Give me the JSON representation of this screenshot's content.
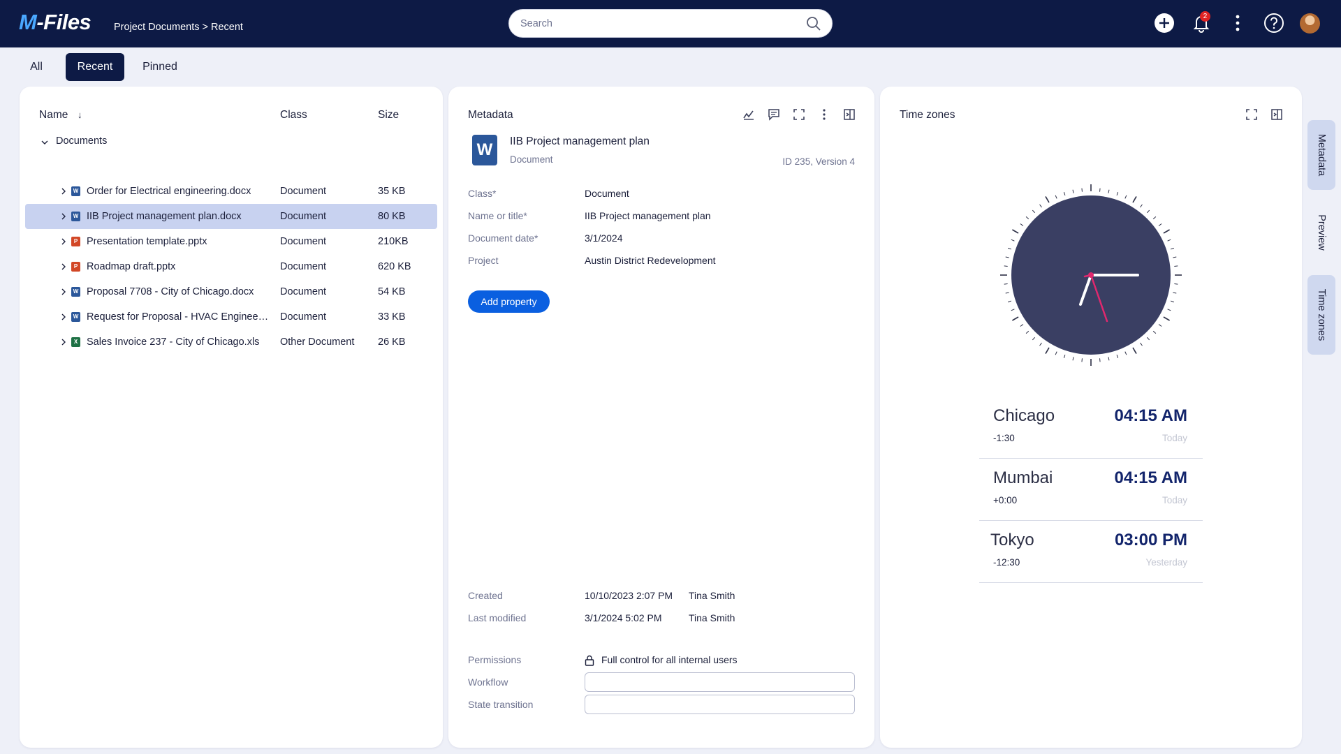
{
  "app": {
    "logo": "M-Files",
    "breadcrumb": "Project Documents > Recent"
  },
  "search": {
    "placeholder": "Search"
  },
  "topbar": {
    "notification_count": "2"
  },
  "tabs": [
    {
      "label": "All",
      "active": false
    },
    {
      "label": "Recent",
      "active": true
    },
    {
      "label": "Pinned",
      "active": false
    }
  ],
  "list": {
    "columns": {
      "name": "Name",
      "class": "Class",
      "size": "Size"
    },
    "group": "Documents",
    "rows": [
      {
        "name": "Order for Electrical engineering.docx",
        "class": "Document",
        "size": "35 KB",
        "type": "W",
        "color": "#2b579a",
        "selected": false
      },
      {
        "name": "IIB Project management plan.docx",
        "class": "Document",
        "size": "80 KB",
        "type": "W",
        "color": "#2b579a",
        "selected": true
      },
      {
        "name": "Presentation template.pptx",
        "class": "Document",
        "size": "210KB",
        "type": "P",
        "color": "#d24726",
        "selected": false
      },
      {
        "name": "Roadmap draft.pptx",
        "class": "Document",
        "size": "620 KB",
        "type": "P",
        "color": "#d24726",
        "selected": false
      },
      {
        "name": "Proposal 7708 - City of Chicago.docx",
        "class": "Document",
        "size": "54 KB",
        "type": "W",
        "color": "#2b579a",
        "selected": false
      },
      {
        "name": "Request for Proposal - HVAC Engineerin...",
        "class": "Document",
        "size": "33 KB",
        "type": "W",
        "color": "#2b579a",
        "selected": false
      },
      {
        "name": "Sales Invoice 237 - City of Chicago.xls",
        "class": "Other Document",
        "size": "26 KB",
        "type": "X",
        "color": "#1e7145",
        "selected": false
      }
    ]
  },
  "metadata": {
    "title": "Metadata",
    "doc_icon": "W",
    "doc_name": "IIB Project management plan",
    "doc_class": "Document",
    "doc_id": "ID 235, Version 4",
    "props": [
      {
        "label": "Class*",
        "value": "Document"
      },
      {
        "label": "Name or title*",
        "value": "IIB Project management plan"
      },
      {
        "label": "Document date*",
        "value": "3/1/2024"
      },
      {
        "label": "Project",
        "value": "Austin District Redevelopment"
      }
    ],
    "add_property": "Add property",
    "created": {
      "label": "Created",
      "date": "10/10/2023 2:07 PM",
      "user": "Tina Smith"
    },
    "modified": {
      "label": "Last modified",
      "date": "3/1/2024 5:02 PM",
      "user": "Tina Smith"
    },
    "permissions": {
      "label": "Permissions",
      "value": "Full control for all internal users"
    },
    "workflow": {
      "label": "Workflow",
      "value": ""
    },
    "state_transition": {
      "label": "State transition",
      "value": ""
    }
  },
  "timezones": {
    "title": "Time zones",
    "items": [
      {
        "city": "Chicago",
        "time": "04:15 AM",
        "offset": "-1:30",
        "day": "Today"
      },
      {
        "city": "Mumbai",
        "time": "04:15 AM",
        "offset": "+0:00",
        "day": "Today"
      },
      {
        "city": "Tokyo",
        "time": "03:00 PM",
        "offset": "-12:30",
        "day": "Yesterday"
      }
    ]
  },
  "side_tabs": [
    {
      "label": "Metadata",
      "active": true
    },
    {
      "label": "Preview",
      "active": false
    },
    {
      "label": "Time zones",
      "active": true
    }
  ],
  "colors": {
    "topbar": "#0d1a45",
    "accent": "#0a5fe0",
    "selected_row": "#c8d2f0",
    "clock_face": "#3a3f63",
    "second_hand": "#e0286e"
  }
}
